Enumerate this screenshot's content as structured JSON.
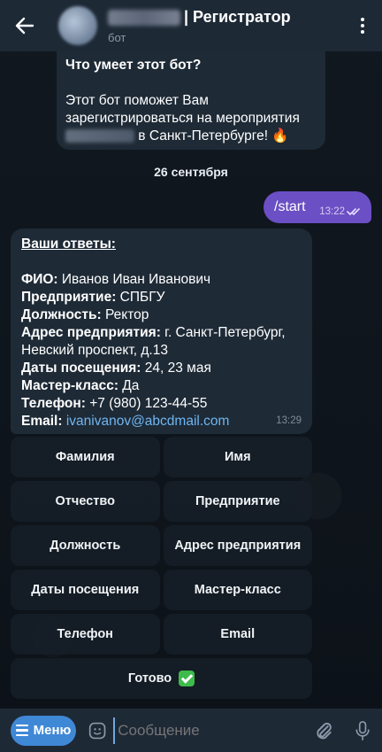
{
  "header": {
    "title": "| Регистратор",
    "subtitle": "бот"
  },
  "bot_info": {
    "title": "Что умеет этот бот?",
    "text_line1": "Этот бот поможет Вам",
    "text_line2": "зарегистрироваться на мероприятия",
    "text_line3_suffix": " в Санкт-Петербурге! 🔥"
  },
  "date_divider": "26 сентября",
  "outgoing": {
    "text": "/start",
    "time": "13:22"
  },
  "answers": {
    "heading": "Ваши ответы:",
    "rows": [
      {
        "label": "ФИО:",
        "value": " Иванов Иван Иванович"
      },
      {
        "label": "Предприятие:",
        "value": " СПБГУ"
      },
      {
        "label": "Должность:",
        "value": " Ректор"
      },
      {
        "label": "Адрес предприятия:",
        "value": " г. Санкт-Петербург,"
      },
      {
        "label": "",
        "value": "Невский проспект, д.13"
      },
      {
        "label": "Даты посещения:",
        "value": " 24, 23 мая"
      },
      {
        "label": "Мастер-класс:",
        "value": " Да"
      },
      {
        "label": "Телефон:",
        "value": " +7 (980) 123-44-55"
      },
      {
        "label": "Email:",
        "value": " "
      }
    ],
    "email": "ivanivanov@abcdmail.com",
    "time": "13:29"
  },
  "keyboard": {
    "buttons": [
      [
        "Фамилия",
        "Имя"
      ],
      [
        "Отчество",
        "Предприятие"
      ],
      [
        "Должность",
        "Адрес предприятия"
      ],
      [
        "Даты посещения",
        "Мастер-класс"
      ],
      [
        "Телефон",
        "Email"
      ]
    ],
    "done_label": "Готово",
    "done_icon": "check-mark-button-icon"
  },
  "input_bar": {
    "menu_label": "Меню",
    "placeholder": "Сообщение"
  },
  "colors": {
    "header_bg": "#1e2936",
    "bubble_bg": "#1e2a36",
    "outgoing_bg": "#6b4fc4",
    "link": "#6fb6f2",
    "menu_button": "#3f88d6"
  }
}
